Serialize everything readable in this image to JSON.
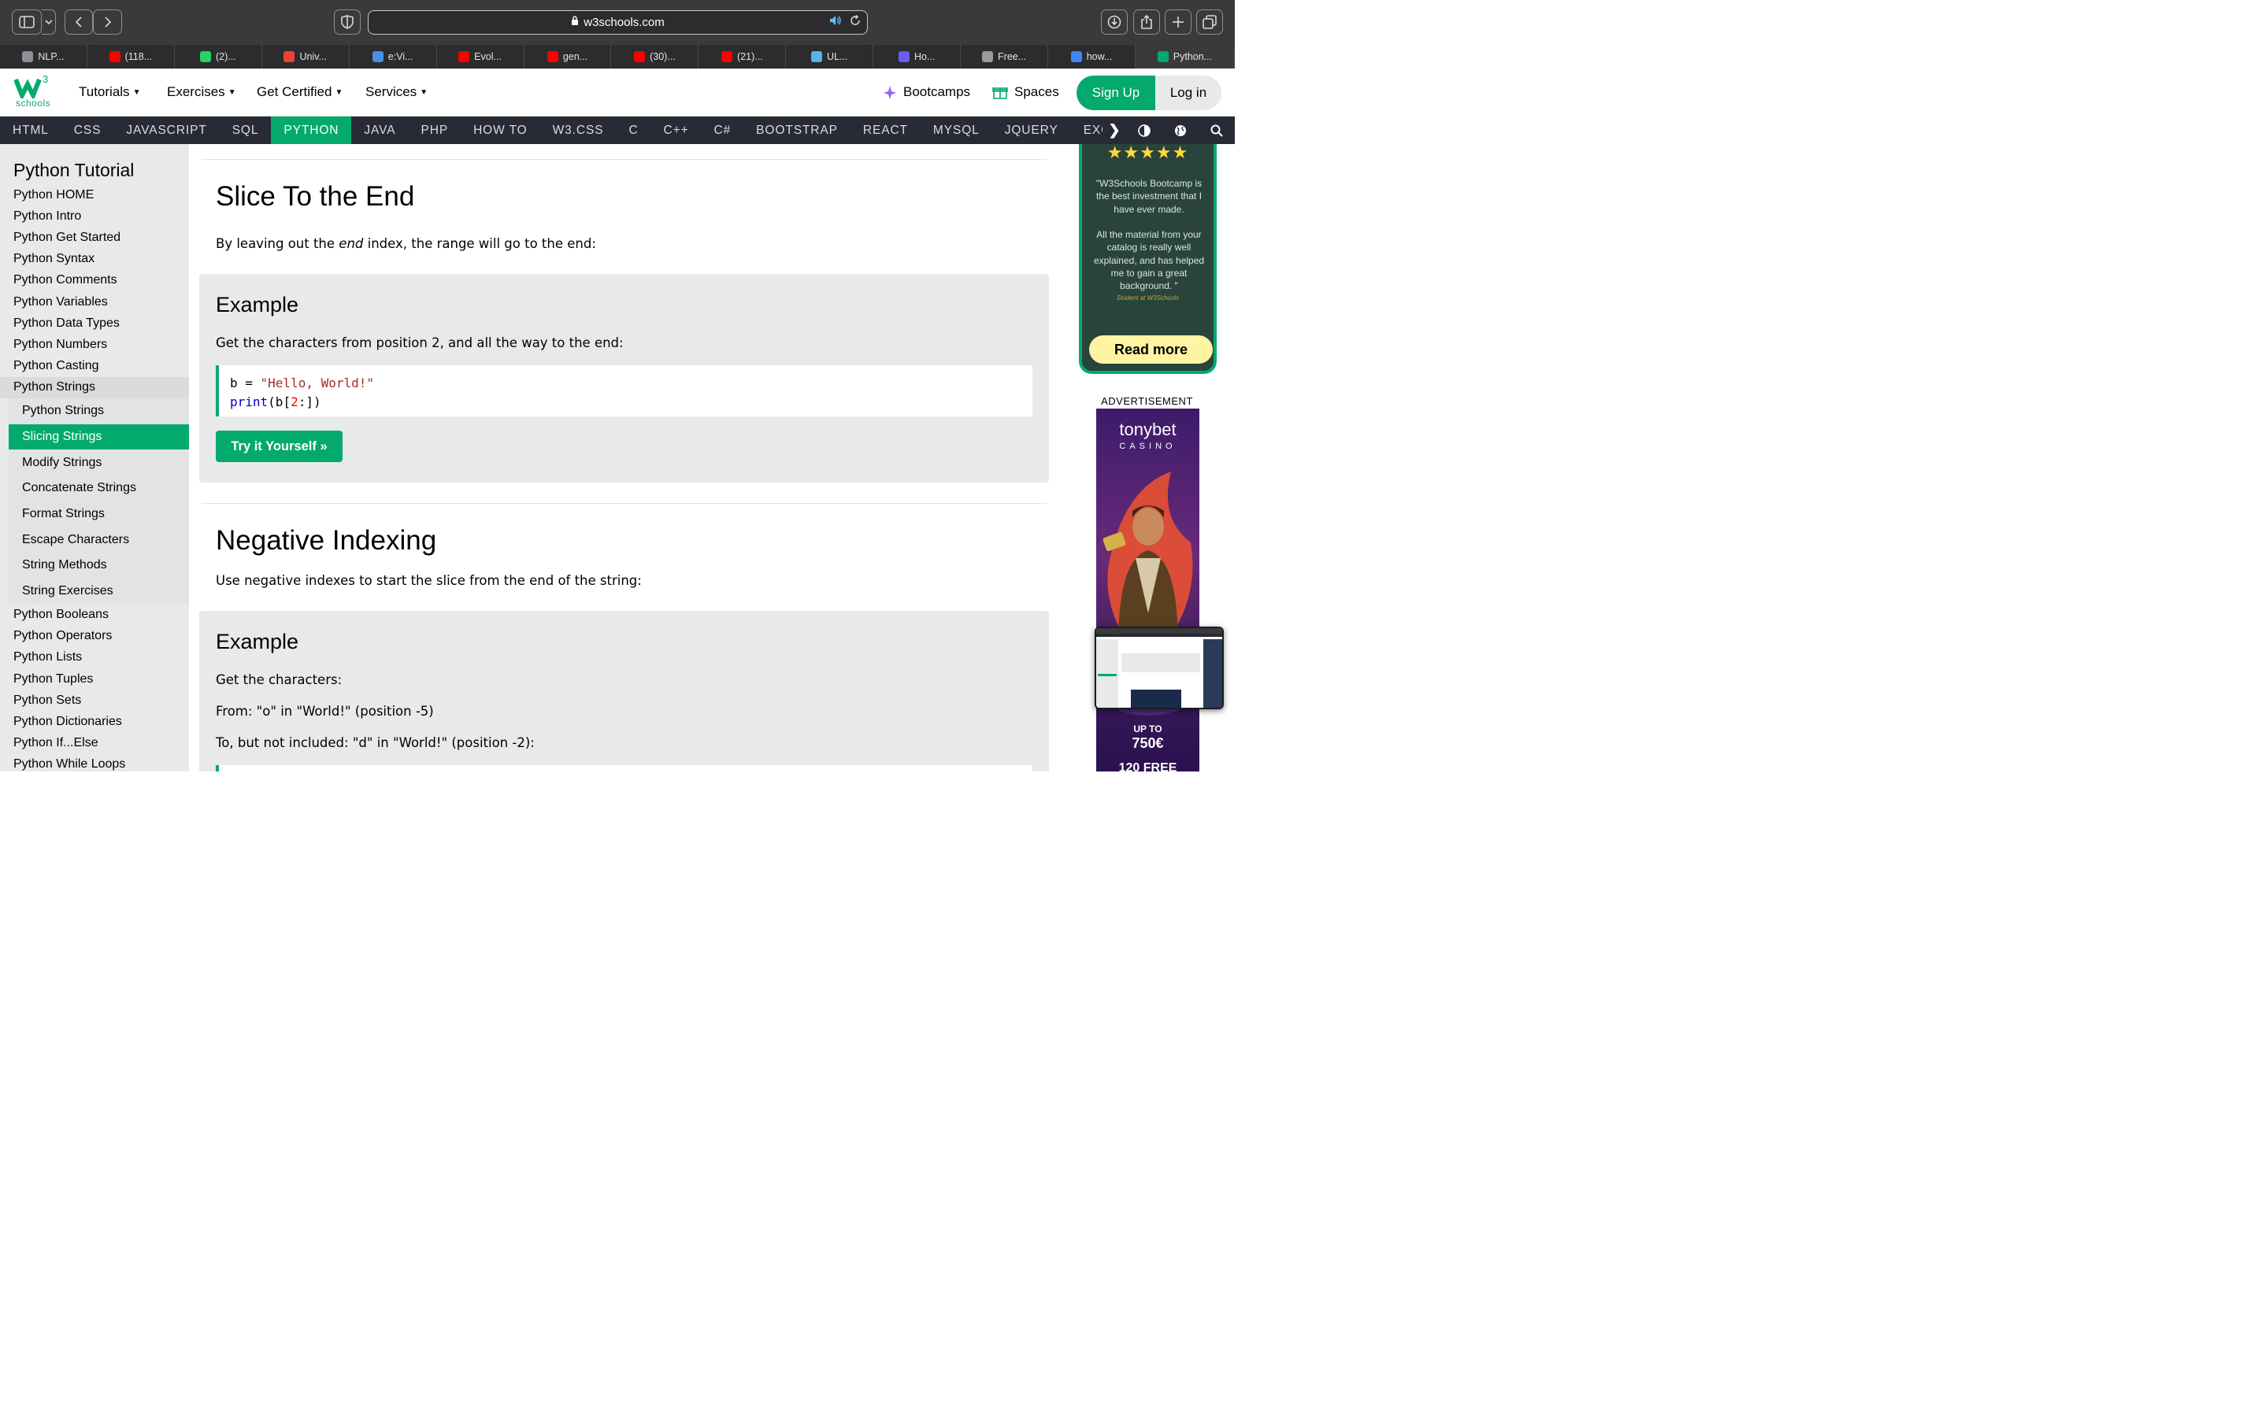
{
  "browser": {
    "url": "w3schools.com",
    "tabs": [
      {
        "label": "NLP...",
        "color": "#8e8e93"
      },
      {
        "label": "(118...",
        "color": "#ff0000"
      },
      {
        "label": "(2)...",
        "color": "#25d366"
      },
      {
        "label": "Univ...",
        "color": "#ea4335"
      },
      {
        "label": "e:Vi...",
        "color": "#4a90e2"
      },
      {
        "label": "Evol...",
        "color": "#ff0000"
      },
      {
        "label": "gen...",
        "color": "#ff0000"
      },
      {
        "label": "(30)...",
        "color": "#ff0000"
      },
      {
        "label": "(21)...",
        "color": "#ff0000"
      },
      {
        "label": "UL...",
        "color": "#5ab4e5"
      },
      {
        "label": "Ho...",
        "color": "#6b5cf0"
      },
      {
        "label": "Free...",
        "color": "#9b9b9b"
      },
      {
        "label": "how...",
        "color": "#4285f4"
      },
      {
        "label": "Python...",
        "color": "#04aa6d"
      }
    ]
  },
  "w3": {
    "logo_text": "schools",
    "logo_sup": "3",
    "menu": [
      "Tutorials",
      "Exercises",
      "Get Certified",
      "Services"
    ],
    "bootcamps": "Bootcamps",
    "spaces": "Spaces",
    "signup": "Sign Up",
    "login": "Log in",
    "subnav": [
      "HTML",
      "CSS",
      "JAVASCRIPT",
      "SQL",
      "PYTHON",
      "JAVA",
      "PHP",
      "HOW TO",
      "W3.CSS",
      "C",
      "C++",
      "C#",
      "BOOTSTRAP",
      "REACT",
      "MYSQL",
      "JQUERY",
      "EXCEL"
    ],
    "subnav_active": "PYTHON",
    "accent": "#04aa6d",
    "dark": "#282a35"
  },
  "sidebar": {
    "title": "Python Tutorial",
    "items_before": [
      "Python HOME",
      "Python Intro",
      "Python Get Started",
      "Python Syntax",
      "Python Comments",
      "Python Variables",
      "Python Data Types",
      "Python Numbers",
      "Python Casting"
    ],
    "open_item": "Python Strings",
    "sub_items": [
      "Python Strings",
      "Slicing Strings",
      "Modify Strings",
      "Concatenate Strings",
      "Format Strings",
      "Escape Characters",
      "String Methods",
      "String Exercises"
    ],
    "sub_active": "Slicing Strings",
    "items_after": [
      "Python Booleans",
      "Python Operators",
      "Python Lists",
      "Python Tuples",
      "Python Sets",
      "Python Dictionaries",
      "Python If...Else",
      "Python While Loops"
    ]
  },
  "main": {
    "section1": {
      "title": "Slice To the End",
      "intro_before": "By leaving out the ",
      "intro_em": "end",
      "intro_after": " index, the range will go to the end:",
      "example_title": "Example",
      "example_text": "Get the characters from position 2, and all the way to the end:",
      "code_line1_var": "b = ",
      "code_line1_str": "\"Hello, World!\"",
      "code_line2_fn": "print",
      "code_line2_a": "(b[",
      "code_line2_num": "2",
      "code_line2_b": ":])",
      "tryit": "Try it Yourself »"
    },
    "section2": {
      "title": "Negative Indexing",
      "intro": "Use negative indexes to start the slice from the end of the string:",
      "example_title": "Example",
      "line1": "Get the characters:",
      "line2": "From: \"o\" in \"World!\" (position -5)",
      "line3": "To, but not included: \"d\" in \"World!\" (position -2):"
    }
  },
  "right": {
    "quote": "\"W3Schools Bootcamp is the best investment that I have ever made.\n\nAll the material from your catalog is really well explained, and has helped me to gain a great background. \"",
    "student": "Student at W3Schools",
    "read_more": "Read more",
    "ad_label": "ADVERTISEMENT",
    "ad_brand": "tonybet",
    "ad_casino": "CASINO",
    "ad_upto": "UP TO",
    "ad_amount": "750€",
    "ad_free": "120 FREE"
  }
}
